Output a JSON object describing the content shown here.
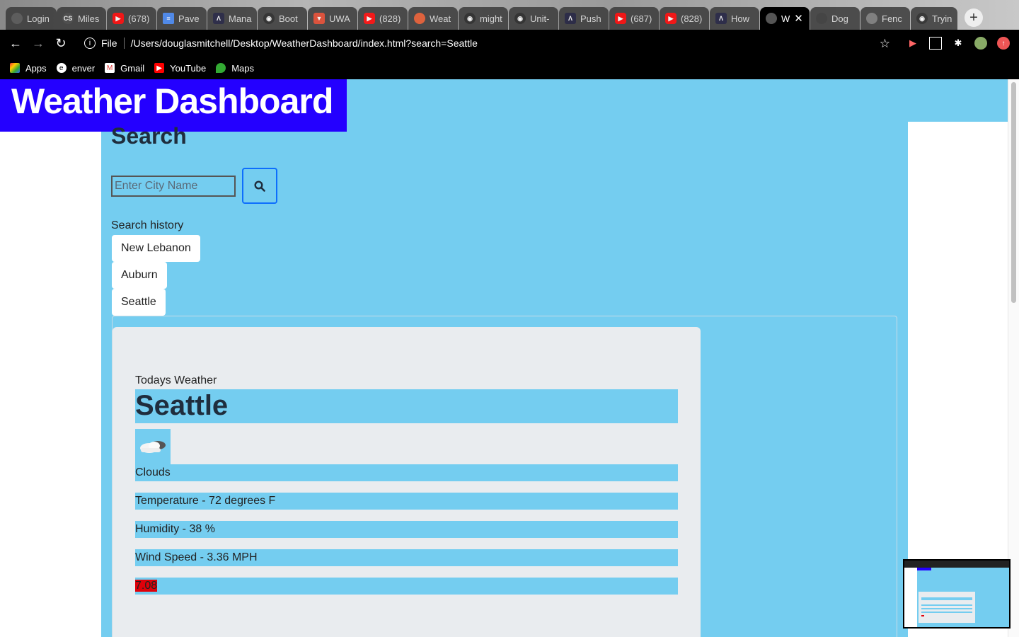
{
  "browser": {
    "tabs": [
      {
        "label": "Login",
        "icon": "globe-icon",
        "color": "#555555"
      },
      {
        "label": "Miles",
        "icon": "cs-icon",
        "color": "#444444"
      },
      {
        "label": "(678)",
        "icon": "youtube-icon",
        "color": "#ff0000"
      },
      {
        "label": "Pave",
        "icon": "docs-icon",
        "color": "#4285f4"
      },
      {
        "label": "Mana",
        "icon": "app-icon",
        "color": "#1a1a3a"
      },
      {
        "label": "Boot",
        "icon": "github-icon",
        "color": "#222222"
      },
      {
        "label": "UWA",
        "icon": "gitlab-icon",
        "color": "#e24329"
      },
      {
        "label": "(828)",
        "icon": "youtube-icon",
        "color": "#ff0000"
      },
      {
        "label": "Weat",
        "icon": "weather-icon",
        "color": "#e8562a"
      },
      {
        "label": "might",
        "icon": "github-icon",
        "color": "#222222"
      },
      {
        "label": "Unit-",
        "icon": "github-icon",
        "color": "#222222"
      },
      {
        "label": "Push",
        "icon": "app-icon",
        "color": "#1a1a3a"
      },
      {
        "label": "(687)",
        "icon": "youtube-icon",
        "color": "#ff0000"
      },
      {
        "label": "(828)",
        "icon": "youtube-icon",
        "color": "#ff0000"
      },
      {
        "label": "How",
        "icon": "app-icon",
        "color": "#1a1a3a"
      },
      {
        "label": "W",
        "icon": "globe-icon",
        "color": "#555555",
        "active": true
      },
      {
        "label": "Dog",
        "icon": "dog-icon",
        "color": "#333333"
      },
      {
        "label": "Fenc",
        "icon": "leaf-icon",
        "color": "#777777"
      },
      {
        "label": "Tryin",
        "icon": "github-icon",
        "color": "#222222"
      }
    ],
    "address": {
      "scheme_label": "File",
      "url": "/Users/douglasmitchell/Desktop/WeatherDashboard/index.html?search=Seattle"
    },
    "bookmarks": [
      {
        "label": "Apps",
        "icon": "apps-grid-icon"
      },
      {
        "label": "enver",
        "icon": "enver-icon"
      },
      {
        "label": "Gmail",
        "icon": "gmail-icon"
      },
      {
        "label": "YouTube",
        "icon": "youtube-icon"
      },
      {
        "label": "Maps",
        "icon": "maps-icon"
      }
    ]
  },
  "app": {
    "title": "Weather Dashboard",
    "search": {
      "heading": "Search",
      "placeholder": "Enter City Name",
      "value": ""
    },
    "history": {
      "label": "Search history",
      "items": [
        "New Lebanon",
        "Auburn",
        "Seattle"
      ]
    },
    "today": {
      "label": "Todays Weather",
      "city": "Seattle",
      "icon": "cloud-icon",
      "description": "Clouds",
      "temperature": "Temperature - 72 degrees F",
      "humidity": "Humidity - 38 %",
      "wind": "Wind Speed - 3.36 MPH",
      "uv": "7.08"
    }
  },
  "colors": {
    "accent": "#74cdf0",
    "title_bg": "#2400ff",
    "uv_high": "#e0000a",
    "card_bg": "#e9ecef"
  }
}
